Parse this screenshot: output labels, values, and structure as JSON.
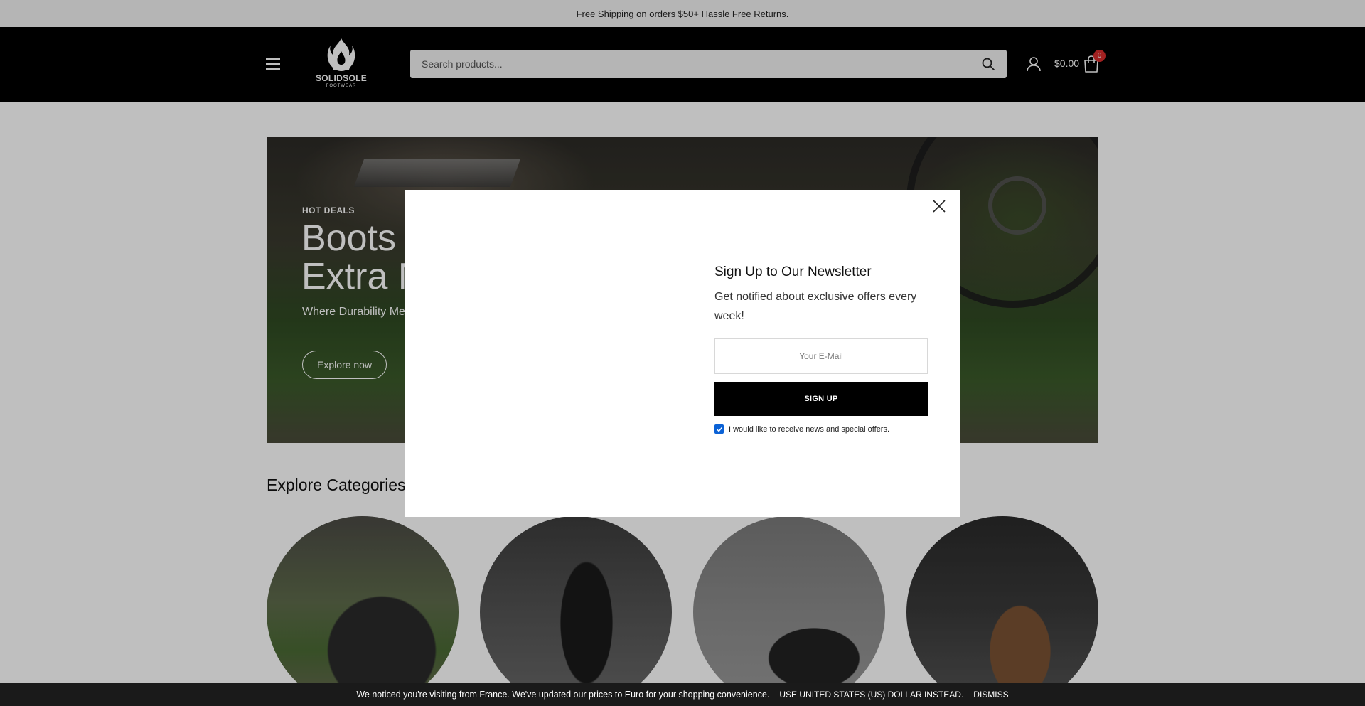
{
  "announcement": {
    "text": "Free Shipping on orders $50+ Hassle Free Returns."
  },
  "header": {
    "logo_text": "SOLIDSOLE",
    "logo_subtext": "FOOTWEAR",
    "search_placeholder": "Search products...",
    "cart_total": "$0.00",
    "cart_count": "0",
    "icons": [
      "menu-icon",
      "search-icon",
      "user-icon",
      "cart-icon"
    ]
  },
  "hero": {
    "label": "HOT DEALS",
    "title_line1": "Boots T",
    "title_line2": "Extra M",
    "subtitle": "Where Durability Me",
    "button_label": "Explore now"
  },
  "categories": {
    "title": "Explore Categories"
  },
  "newsletter": {
    "title": "Sign Up to Our Newsletter",
    "description": "Get notified about exclusive offers every week!",
    "email_placeholder": "Your E-Mail",
    "button_label": "SIGN UP",
    "consent_label": "I would like to receive news and special offers.",
    "consent_checked": true
  },
  "currency_notice": {
    "message": "We noticed you're visiting from France. We've updated our prices to Euro for your shopping convenience.",
    "use_usd_label": "Use United States (US) dollar instead.",
    "dismiss_label": "Dismiss"
  },
  "colors": {
    "header_bg": "#000000",
    "badge": "#d82c2c",
    "checkbox": "#0b62d6"
  }
}
